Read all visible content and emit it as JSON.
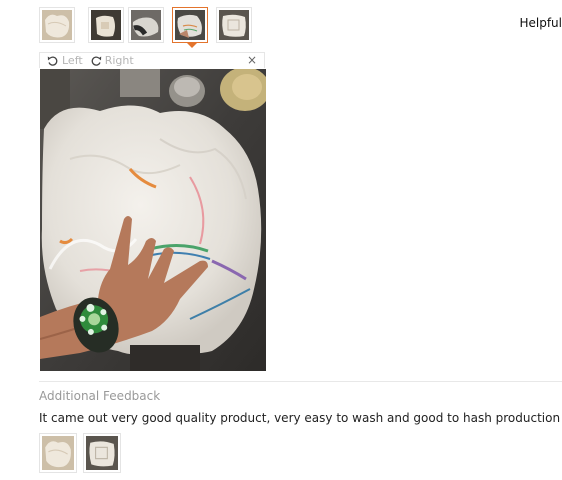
{
  "thumbnails": [
    {
      "icon": "photo-thumbnail-crumpled-bag",
      "selected": false
    },
    {
      "icon": "photo-thumbnail-bag-on-table",
      "selected": false
    },
    {
      "icon": "photo-thumbnail-dark-bag",
      "selected": false
    },
    {
      "icon": "photo-thumbnail-bag-closeup",
      "selected": true
    },
    {
      "icon": "photo-thumbnail-bag-folded",
      "selected": false
    }
  ],
  "helpful_label": "Helpful",
  "viewer": {
    "rotate_left_label": "Left",
    "rotate_right_label": "Right",
    "close_label": "×",
    "photo_icon": "large-photo-hand-holding-bag"
  },
  "additional_feedback": {
    "title": "Additional Feedback",
    "text": "It came out very good quality product, very easy to wash and good to hash production",
    "thumbnails": [
      {
        "icon": "photo-thumbnail-crumpled-bag"
      },
      {
        "icon": "photo-thumbnail-bag-folded"
      }
    ]
  },
  "colors": {
    "accent": "#e3742d",
    "muted_text": "#999999",
    "border": "#e4e4e4"
  }
}
